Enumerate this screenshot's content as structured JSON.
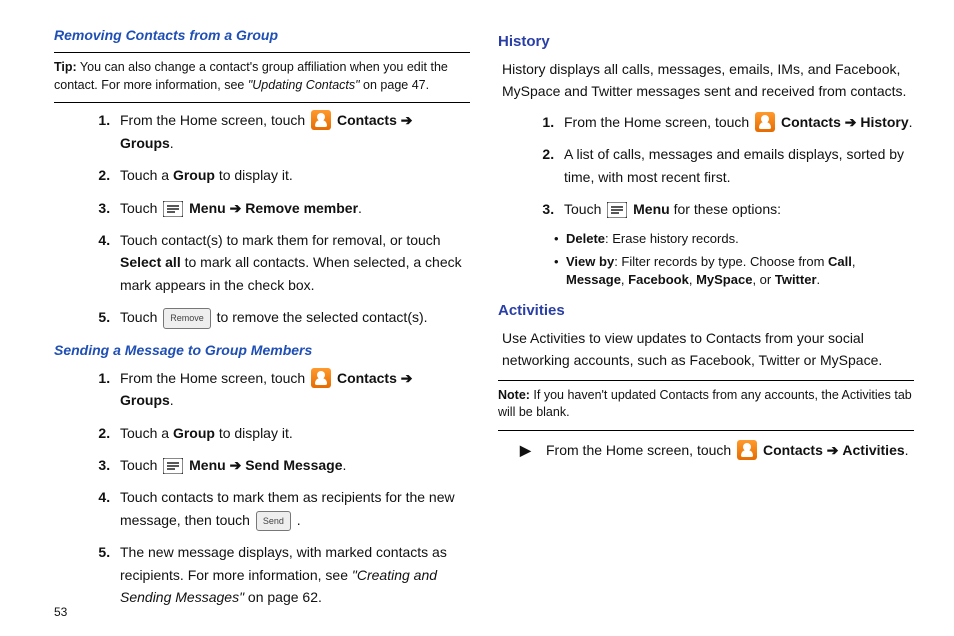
{
  "left": {
    "sub1_title": "Removing Contacts from a Group",
    "tip_label": "Tip:",
    "tip_text_1": " You can also change a contact's group affiliation when you edit the contact. For more information, see ",
    "tip_ref": "\"Updating Contacts\"",
    "tip_text_2": " on page 47.",
    "steps1": {
      "s1_a": "From the Home screen, touch ",
      "s1_b": " Contacts ",
      "s1_c": " Groups",
      "s2_a": "Touch a ",
      "s2_b": "Group",
      "s2_c": " to display it.",
      "s3_a": "Touch ",
      "s3_b": " Menu ",
      "s3_c": " Remove member",
      "s4_a": "Touch contact(s) to mark them for removal, or touch ",
      "s4_b": "Select all",
      "s4_c": " to mark all contacts. When selected, a check mark appears in the check box.",
      "s5_a": "Touch ",
      "s5_b": "Remove",
      "s5_c": " to remove the selected contact(s)."
    },
    "sub2_title": "Sending a Message to Group Members",
    "steps2": {
      "s1_a": "From the Home screen, touch ",
      "s1_b": " Contacts ",
      "s1_c": " Groups",
      "s2_a": "Touch a ",
      "s2_b": "Group",
      "s2_c": " to display it.",
      "s3_a": "Touch ",
      "s3_b": " Menu ",
      "s3_c": " Send Message",
      "s4_a": "Touch contacts to mark them as recipients for the new message, then touch ",
      "s4_b": "Send",
      "s5_a": "The new message displays, with marked contacts as recipients. For more information, see ",
      "s5_ref": "\"Creating and Sending Messages\"",
      "s5_b": " on page 62."
    }
  },
  "right": {
    "section1_title": "History",
    "section1_para": "History displays all calls, messages, emails, IMs, and Facebook, MySpace and Twitter messages sent and received from contacts.",
    "steps": {
      "s1_a": "From the Home screen, touch ",
      "s1_b": " Contacts ",
      "s1_c": " History",
      "s2": "A list of calls, messages and emails displays, sorted by time, with most recent first.",
      "s3_a": "Touch ",
      "s3_b": " Menu ",
      "s3_c": " for these options:"
    },
    "bullets": {
      "b1_a": "Delete",
      "b1_b": ": Erase history records.",
      "b2_a": "View by",
      "b2_b": ": Filter records by type. Choose from ",
      "b2_c": "Call",
      "b2_d": "Message",
      "b2_e": "Facebook",
      "b2_f": "MySpace",
      "b2_g": "Twitter"
    },
    "section2_title": "Activities",
    "section2_para": "Use Activities to view updates to Contacts from your social networking accounts, such as Facebook, Twitter or MySpace.",
    "note_label": "Note:",
    "note_text": " If you haven't updated Contacts from any accounts, the Activities tab will be blank.",
    "arrow_item": {
      "a": "From the Home screen, touch ",
      "b": " Contacts ",
      "c": " Activities"
    }
  },
  "glyphs": {
    "arrow_right": "➔",
    "play": "䷣"
  },
  "page_number": "53"
}
